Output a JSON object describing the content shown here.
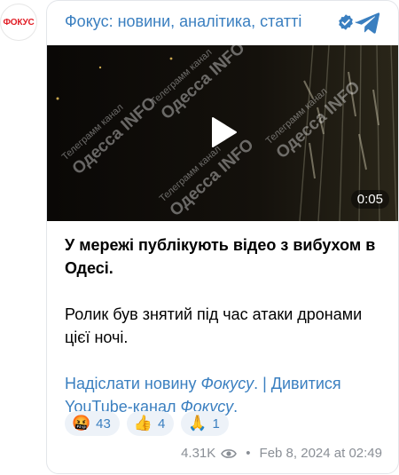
{
  "avatar": {
    "logo_text": "ФОКУС"
  },
  "header": {
    "channel_name": "Фокус: новини, аналітика, статті",
    "verified_icon": "verified-check-icon",
    "telegram_icon": "telegram-icon"
  },
  "video": {
    "duration": "0:05",
    "watermark_small": "Телеграмм канал",
    "watermark_big": "Одесса INFO",
    "play_icon": "play-icon"
  },
  "post": {
    "headline": "У мережі публікують відео з вибухом в Одесі.",
    "body": "Ролик був знятий під час атаки дронами цієї ночі.",
    "link1_a": "Надіслати новину ",
    "link1_b": "Фокусу",
    "separator": ". | ",
    "link2_a": "Дивитися YouTube-канал ",
    "link2_b": "Фокусу",
    "link2_end": "."
  },
  "reactions": [
    {
      "emoji": "🤬",
      "count": "43"
    },
    {
      "emoji": "👍",
      "count": "4"
    },
    {
      "emoji": "🙏",
      "count": "1"
    }
  ],
  "meta": {
    "views": "4.31K",
    "views_icon": "eye-icon",
    "date": "Feb 8, 2024 at 02:49"
  },
  "colors": {
    "accent": "#3a7fc0",
    "logo_red": "#e11d25",
    "muted": "#8a8f96"
  }
}
